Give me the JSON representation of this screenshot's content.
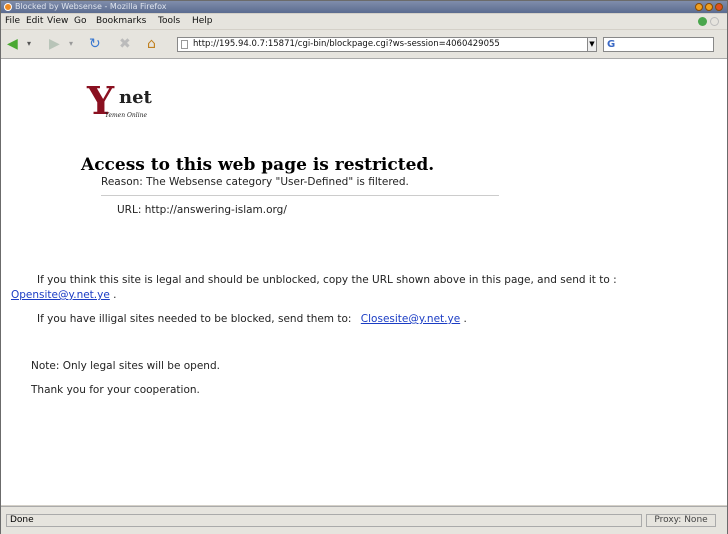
{
  "window": {
    "title": "Blocked by Websense - Mozilla Firefox"
  },
  "menu": [
    "File",
    "Edit",
    "View",
    "Go",
    "Bookmarks",
    "Tools",
    "Help"
  ],
  "toolbar": {
    "url": "http://195.94.0.7:15871/cgi-bin/blockpage.cgi?ws-session=4060429055",
    "search_placeholder": ""
  },
  "logo": {
    "mark": "Y",
    "name": "net",
    "tagline": "Yemen Online"
  },
  "page": {
    "heading": "Access to this web page is restricted.",
    "reason": "Reason: The Websense category \"User-Defined\" is filtered.",
    "url_line": "URL: http://answering-islam.org/",
    "unblock_text": "If you think this site is legal and should be unblocked, copy the URL shown above in this page, and send it to :",
    "unblock_email": "Opensite@y.net.ye",
    "unblock_tail": ".",
    "block_text": "If you have illigal sites needed to be blocked, send them to:",
    "block_email": "Closesite@y.net.ye",
    "block_tail": ".",
    "note": "Note: Only legal sites will be opend.",
    "thanks": "Thank you for your cooperation."
  },
  "status": {
    "left": "Done",
    "right": "Proxy: None"
  },
  "colors": {
    "link": "#1a3cc4",
    "logo_red": "#8a1020",
    "titlebar": "#5b6c90"
  }
}
